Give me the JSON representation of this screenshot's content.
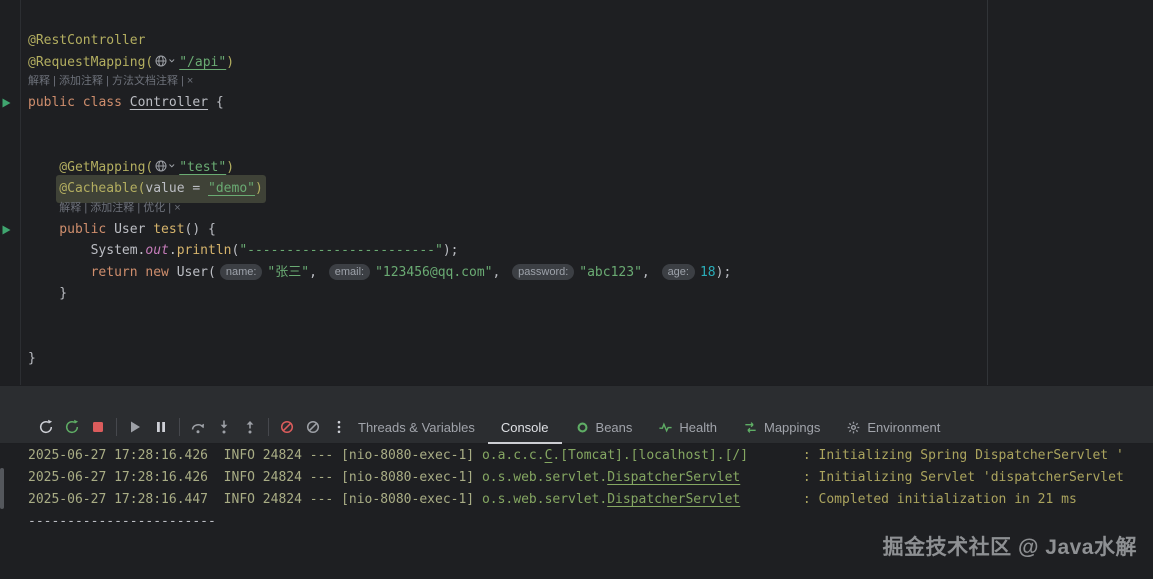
{
  "watermark": "掘金技术社区 @ Java水解",
  "colors": {
    "editor-bg": "#1e1f22",
    "panel-bg": "#2b2d30",
    "border": "#1d1e21",
    "text-default": "#bcbec4",
    "annotation": "#b3ae60",
    "keyword": "#cf8e6d",
    "string": "#6aab73",
    "number": "#2aacb8",
    "method": "#d6b46c",
    "field": "#c77dbb",
    "inlay-hint-bg": "#3c3f44",
    "inlay-hint-fg": "#9da2aa",
    "ai-hint": "#6d717a",
    "line-highlight": "#3f4237",
    "log-prefix": "#a9ad85",
    "log-logger": "#85a762",
    "log-message": "#aba45e",
    "accent-green": "#5fad65",
    "accent-red": "#db5c5c",
    "tab-active": "#dfe1e5",
    "tab-inactive": "#a1a4ab",
    "run-arrow": "#3fa56f"
  },
  "editor": {
    "lines": [
      {
        "tokens": [
          {
            "t": "@RestController",
            "c": "a"
          }
        ]
      },
      {
        "tokens": [
          {
            "t": "@RequestMapping(",
            "c": "a"
          },
          {
            "icon": "globe-inlay-icon"
          },
          {
            "t": "\"/api\"",
            "c": "s",
            "u": true
          },
          {
            "t": ")",
            "c": "a"
          }
        ]
      },
      {
        "hint": "解释 | 添加注释 | 方法文档注释 | ×"
      },
      {
        "gutter": "run",
        "tokens": [
          {
            "t": "public class ",
            "c": "k"
          },
          {
            "t": "Controller",
            "c": "d",
            "u": true
          },
          {
            "t": " {",
            "c": "d"
          }
        ]
      },
      {
        "blank": true
      },
      {
        "blank": true
      },
      {
        "ind": 4,
        "tokens": [
          {
            "t": "@GetMapping(",
            "c": "a"
          },
          {
            "icon": "globe-inlay-icon"
          },
          {
            "t": "\"test\"",
            "c": "s",
            "u": true
          },
          {
            "t": ")",
            "c": "a"
          }
        ]
      },
      {
        "ind": 4,
        "hl": true,
        "tokens": [
          {
            "t": "@Cacheable(",
            "c": "a"
          },
          {
            "t": "value = ",
            "c": "d"
          },
          {
            "t": "\"demo\"",
            "c": "s",
            "u": true
          },
          {
            "t": ")",
            "c": "a"
          }
        ]
      },
      {
        "ind": 4,
        "hint": "解释 | 添加注释 | 优化 | ×"
      },
      {
        "ind": 4,
        "gutter": "run",
        "tokens": [
          {
            "t": "public ",
            "c": "k"
          },
          {
            "t": "User ",
            "c": "d"
          },
          {
            "t": "test",
            "c": "m"
          },
          {
            "t": "() {",
            "c": "d"
          }
        ]
      },
      {
        "ind": 8,
        "tokens": [
          {
            "t": "System.",
            "c": "d"
          },
          {
            "t": "out",
            "c": "f"
          },
          {
            "t": ".",
            "c": "d"
          },
          {
            "t": "println",
            "c": "m"
          },
          {
            "t": "(",
            "c": "d"
          },
          {
            "t": "\"------------------------\"",
            "c": "s"
          },
          {
            "t": ");",
            "c": "d"
          }
        ]
      },
      {
        "ind": 8,
        "tokens": [
          {
            "t": "return ",
            "c": "k"
          },
          {
            "t": "new ",
            "c": "k"
          },
          {
            "t": "User(",
            "c": "d"
          },
          {
            "pill": "name:"
          },
          {
            "t": "\"张三\"",
            "c": "s"
          },
          {
            "t": ", ",
            "c": "d"
          },
          {
            "pill": "email:"
          },
          {
            "t": "\"123456@qq.com\"",
            "c": "s"
          },
          {
            "t": ", ",
            "c": "d"
          },
          {
            "pill": "password:"
          },
          {
            "t": "\"abc123\"",
            "c": "s"
          },
          {
            "t": ", ",
            "c": "d"
          },
          {
            "pill": "age:"
          },
          {
            "t": "18",
            "c": "n"
          },
          {
            "t": ");",
            "c": "d"
          }
        ]
      },
      {
        "ind": 4,
        "tokens": [
          {
            "t": "}",
            "c": "d"
          }
        ]
      },
      {
        "blank": true
      },
      {
        "blank": true
      },
      {
        "tokens": [
          {
            "t": "}",
            "c": "d"
          }
        ]
      }
    ]
  },
  "toolbar": {
    "icons": [
      {
        "name": "rerun-icon"
      },
      {
        "name": "restart-icon"
      },
      {
        "name": "stop-icon"
      },
      "sep",
      {
        "name": "resume-icon"
      },
      {
        "name": "pause-icon"
      },
      "sep",
      {
        "name": "step-over-icon"
      },
      {
        "name": "step-into-icon"
      },
      {
        "name": "step-out-icon"
      },
      "sep",
      {
        "name": "mute-breakpoints-icon"
      },
      {
        "name": "view-breakpoints-icon"
      },
      {
        "name": "more-options-icon"
      }
    ]
  },
  "tabs": [
    {
      "label": "Threads & Variables",
      "name": "threads-variables",
      "active": false
    },
    {
      "label": "Console",
      "name": "console",
      "active": true
    },
    {
      "label": "Beans",
      "name": "beans",
      "active": false,
      "icon": "beans-icon"
    },
    {
      "label": "Health",
      "name": "health",
      "active": false,
      "icon": "health-icon"
    },
    {
      "label": "Mappings",
      "name": "mappings",
      "active": false,
      "icon": "mappings-icon"
    },
    {
      "label": "Environment",
      "name": "environment",
      "active": false,
      "icon": "environment-icon"
    }
  ],
  "console": {
    "lines": [
      {
        "tokens": [
          {
            "t": "2025-06-27 17:28:16.426  INFO 24824 --- [nio-8080-exec-1] ",
            "c": "pre"
          },
          {
            "t": "o.a.c.c.",
            "c": "lg"
          },
          {
            "t": "C",
            "c": "lg",
            "u": true
          },
          {
            "t": ".[Tomcat].[localhost].[/]",
            "c": "lg"
          },
          {
            "t": "      ",
            "c": "lg"
          },
          {
            "t": " : ",
            "c": "msg"
          },
          {
            "t": "Initializing Spring DispatcherServlet '",
            "c": "msg"
          }
        ]
      },
      {
        "tokens": [
          {
            "t": "2025-06-27 17:28:16.426  INFO 24824 --- [nio-8080-exec-1] ",
            "c": "pre"
          },
          {
            "t": "o.s.web.servlet.",
            "c": "lg"
          },
          {
            "t": "DispatcherServlet",
            "c": "lg",
            "u": true
          },
          {
            "t": "       ",
            "c": "lg"
          },
          {
            "t": " : ",
            "c": "msg"
          },
          {
            "t": "Initializing Servlet 'dispatcherServlet",
            "c": "msg"
          }
        ]
      },
      {
        "tokens": [
          {
            "t": "2025-06-27 17:28:16.447  INFO 24824 --- [nio-8080-exec-1] ",
            "c": "pre"
          },
          {
            "t": "o.s.web.servlet.",
            "c": "lg"
          },
          {
            "t": "DispatcherServlet",
            "c": "lg",
            "u": true
          },
          {
            "t": "       ",
            "c": "lg"
          },
          {
            "t": " : ",
            "c": "msg"
          },
          {
            "t": "Completed initialization in 21 ms",
            "c": "msg"
          }
        ]
      },
      {
        "tokens": [
          {
            "t": "------------------------",
            "c": "plain"
          }
        ]
      }
    ]
  }
}
